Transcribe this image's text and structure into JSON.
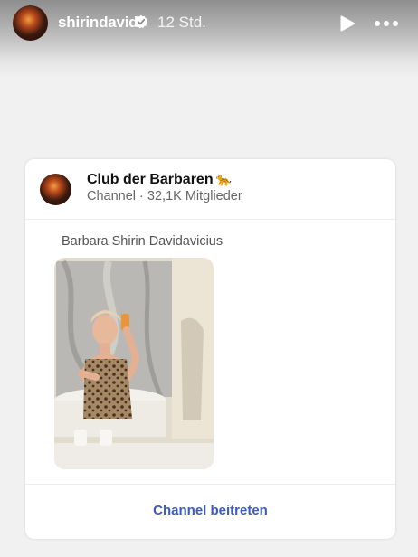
{
  "story": {
    "username": "shirindavid",
    "time_ago": "12 Std."
  },
  "post": {
    "channel_name": "Club der Barbaren",
    "channel_emoji": "🐆",
    "channel_type": "Channel",
    "member_count": "32,1K Mitglieder",
    "author": "Barbara Shirin Davidavicius",
    "image_description_icon": "photo",
    "join_label": "Channel beitreten"
  },
  "colors": {
    "accent_link": "#3b5bbf",
    "card_background": "#ffffff",
    "page_background": "#f1f1f1"
  }
}
